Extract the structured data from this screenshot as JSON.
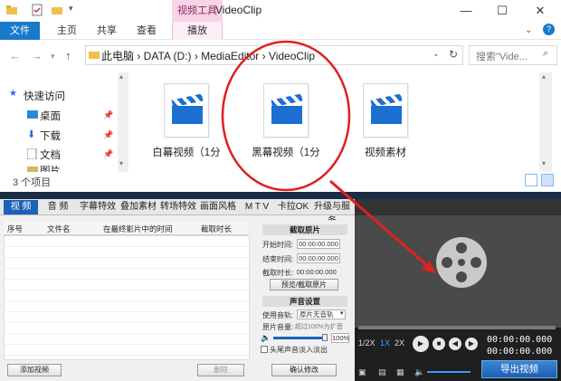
{
  "explorer": {
    "title": "VideoClip",
    "context_tab": "视频工具",
    "ribbon_tabs": [
      "文件",
      "主页",
      "共享",
      "查看",
      "播放"
    ],
    "window_controls": {
      "minimize": "—",
      "maximize": "☐",
      "close": "✕"
    },
    "breadcrumb": "此电脑  ›  DATA (D:)  ›  MediaEditor  ›  VideoClip",
    "search_placeholder": "搜索\"Vide...",
    "nav_items": [
      {
        "label": "快速访问"
      },
      {
        "label": "桌面"
      },
      {
        "label": "下载"
      },
      {
        "label": "文档"
      },
      {
        "label": "图片"
      }
    ],
    "files": [
      {
        "label": "白幕视频（1分"
      },
      {
        "label": "黑幕视频（1分"
      },
      {
        "label": "视频素材"
      }
    ],
    "status": "3 个项目"
  },
  "editor": {
    "tabs": [
      "视 频",
      "音 频",
      "字幕特效",
      "叠加素材",
      "转场特效",
      "画面风格",
      "M T V",
      "卡拉OK",
      "升级与服务"
    ],
    "list_headers": [
      "序号",
      "文件名",
      "在最终影片中的时间",
      "截取时长"
    ],
    "add_video": "添加视频",
    "delete": "删除",
    "clip_section": "截取原片",
    "start_label": "开始时间:",
    "start_value": "00:00:00.000",
    "end_label": "结束时间:",
    "end_value": "00:00:00.000",
    "duration_label": "截取时长:",
    "duration_value": "00:00:00.000",
    "preview_button": "预览/截取原片",
    "audio_section": "声音设置",
    "track_label": "使用音轨:",
    "track_value": "原片无音轨",
    "volume_label": "原片音量:",
    "volume_hint": "超过100%为扩音",
    "volume_value": "100%",
    "fade_label": "头尾声音淡入淡出",
    "confirm_button": "确认修改",
    "speeds": [
      "1/2X",
      "1X",
      "2X"
    ],
    "time_current": "00:00:00.000",
    "time_total": "00:00:00.000",
    "export_button": "导出视频"
  }
}
